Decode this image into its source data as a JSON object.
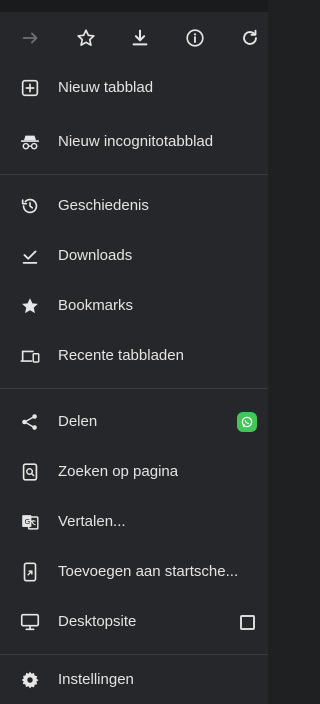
{
  "toolbar": {
    "icons": [
      "forward-arrow-icon",
      "star-outline-icon",
      "download-icon",
      "info-icon",
      "reload-icon"
    ]
  },
  "menu": {
    "items": [
      {
        "label": "Nieuw tabblad",
        "icon": "new-tab-icon"
      },
      {
        "label": "Nieuw incognitotabblad",
        "icon": "incognito-icon"
      },
      {
        "label": "Geschiedenis",
        "icon": "history-icon"
      },
      {
        "label": "Downloads",
        "icon": "downloads-icon"
      },
      {
        "label": "Bookmarks",
        "icon": "star-icon"
      },
      {
        "label": "Recente tabbladen",
        "icon": "devices-icon"
      },
      {
        "label": "Delen",
        "icon": "share-icon"
      },
      {
        "label": "Zoeken op pagina",
        "icon": "find-in-page-icon"
      },
      {
        "label": "Vertalen...",
        "icon": "translate-icon"
      },
      {
        "label": "Toevoegen aan startsche...",
        "icon": "add-to-home-icon"
      },
      {
        "label": "Desktopsite",
        "icon": "desktop-icon"
      },
      {
        "label": "Instellingen",
        "icon": "settings-icon"
      }
    ],
    "desktop_site_checked": false,
    "share_app": "whatsapp-icon"
  },
  "colors": {
    "background": "#26272a",
    "text": "#e4e4e4",
    "divider": "#3a3b3e",
    "whatsapp": "#43c659"
  }
}
